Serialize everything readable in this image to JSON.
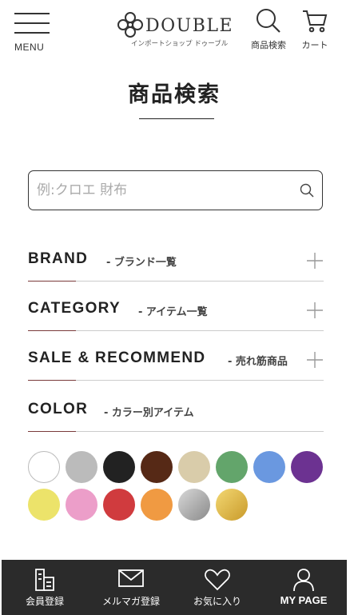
{
  "header": {
    "menu_label": "MENU",
    "logo_name": "DOUBLE",
    "logo_sub": "インポートショップ ドゥーブル",
    "search_label": "商品検索",
    "cart_label": "カート"
  },
  "page_title": "商品検索",
  "search": {
    "placeholder": "例:クロエ 財布",
    "value": ""
  },
  "sections": [
    {
      "title": "BRAND",
      "subtitle": "- ブランド一覧"
    },
    {
      "title": "CATEGORY",
      "subtitle": "- アイテム一覧"
    },
    {
      "title": "SALE & RECOMMEND",
      "subtitle": "- 売れ筋商品"
    },
    {
      "title": "COLOR",
      "subtitle": "- カラー別アイテム"
    }
  ],
  "colors": [
    {
      "name": "white",
      "hex": "#ffffff"
    },
    {
      "name": "gray",
      "hex": "#bbbbbb"
    },
    {
      "name": "black",
      "hex": "#222222"
    },
    {
      "name": "brown",
      "hex": "#562916"
    },
    {
      "name": "beige",
      "hex": "#d9ccaa"
    },
    {
      "name": "green",
      "hex": "#63a56b"
    },
    {
      "name": "blue",
      "hex": "#6a98e0"
    },
    {
      "name": "purple",
      "hex": "#6c3291"
    },
    {
      "name": "yellow",
      "hex": "#ece36a"
    },
    {
      "name": "pink",
      "hex": "#ec9ec9"
    },
    {
      "name": "red",
      "hex": "#d03b3e"
    },
    {
      "name": "orange",
      "hex": "#f09a42"
    },
    {
      "name": "silver",
      "hex": "#a8a8a8"
    },
    {
      "name": "gold",
      "hex": "#e2bd4a"
    }
  ],
  "footer": [
    {
      "label": "会員登録",
      "icon": "register-icon"
    },
    {
      "label": "メルマガ登録",
      "icon": "mail-icon"
    },
    {
      "label": "お気に入り",
      "icon": "heart-icon"
    },
    {
      "label": "MY PAGE",
      "icon": "user-icon"
    }
  ]
}
